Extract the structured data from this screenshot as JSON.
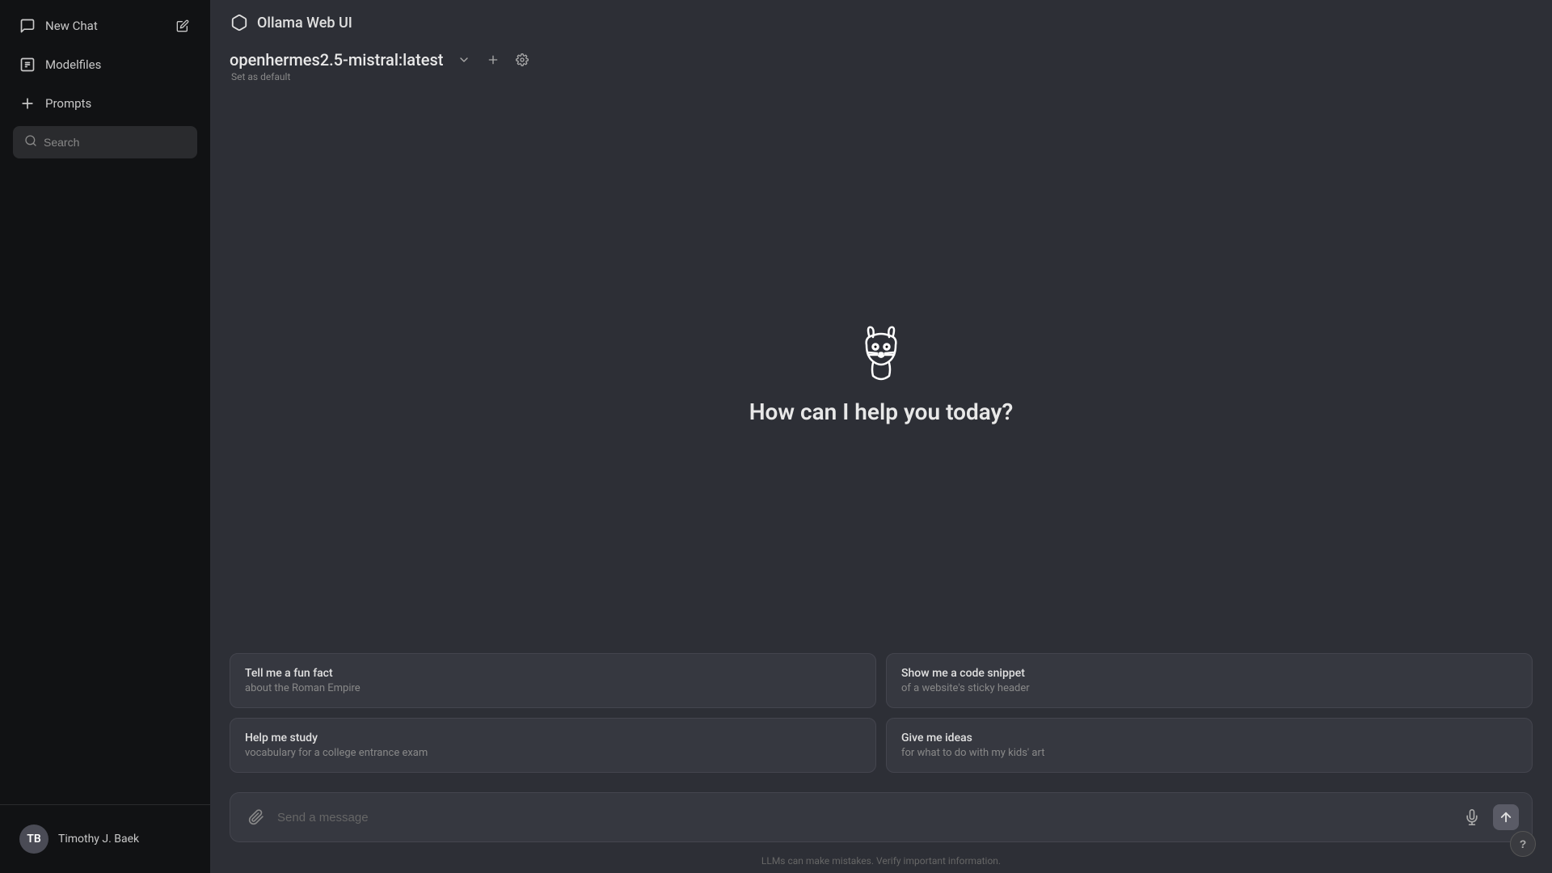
{
  "sidebar": {
    "items": [
      {
        "id": "new-chat",
        "label": "New Chat",
        "icon": "new-chat-icon"
      },
      {
        "id": "modelfiles",
        "label": "Modelfiles",
        "icon": "modelfiles-icon"
      },
      {
        "id": "prompts",
        "label": "Prompts",
        "icon": "prompts-icon"
      }
    ],
    "search": {
      "placeholder": "Search"
    },
    "user": {
      "name": "Timothy J. Baek",
      "initials": "TB"
    }
  },
  "topbar": {
    "app_name": "Ollama Web UI"
  },
  "model": {
    "name": "openhermes2.5-mistral:latest",
    "set_default_label": "Set as default"
  },
  "welcome": {
    "heading": "How can I help you today?"
  },
  "suggestions": [
    {
      "title": "Tell me a fun fact",
      "subtitle": "about the Roman Empire"
    },
    {
      "title": "Show me a code snippet",
      "subtitle": "of a website's sticky header"
    },
    {
      "title": "Help me study",
      "subtitle": "vocabulary for a college entrance exam"
    },
    {
      "title": "Give me ideas",
      "subtitle": "for what to do with my kids' art"
    }
  ],
  "input": {
    "placeholder": "Send a message"
  },
  "footer": {
    "disclaimer": "LLMs can make mistakes. Verify important information."
  }
}
